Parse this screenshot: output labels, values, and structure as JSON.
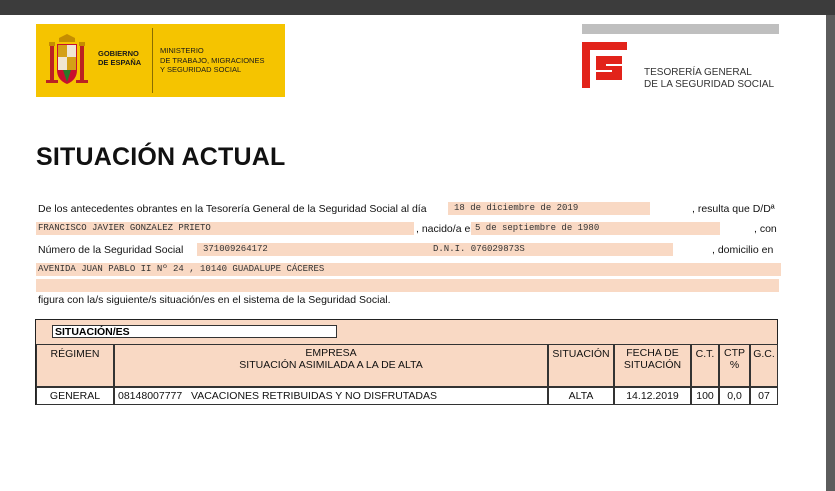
{
  "logos": {
    "gobierno": [
      "GOBIERNO",
      "DE ESPAÑA"
    ],
    "ministerio": [
      "MINISTERIO",
      "DE TRABAJO, MIGRACIONES",
      "Y SEGURIDAD SOCIAL"
    ],
    "tgss": [
      "TESORERÍA GENERAL",
      "DE LA SEGURIDAD SOCIAL"
    ]
  },
  "title": "SITUACIÓN ACTUAL",
  "body": {
    "line1_prefix": "De los antecedentes obrantes en la Tesorería General de la Seguridad Social al día",
    "date_issue": "18 de diciembre de 2019",
    "line1_suffix": ", resulta que D/Dª",
    "name": "FRANCISCO JAVIER GONZALEZ PRIETO",
    "born_label": ", nacido/a el",
    "birth_date": "5 de septiembre de 1980",
    "con_label": ", con",
    "nss_label": "Número de la Seguridad Social",
    "nss": "371009264172",
    "dni": "D.N.I. 076029873S",
    "domicilio_label": ", domicilio en",
    "address": "AVENIDA JUAN PABLO II Nº 24 , 10140 GUADALUPE CÁCERES",
    "address_line2": "",
    "closing": "figura con la/s siguiente/s situación/es en el sistema de la Seguridad Social."
  },
  "situacion": {
    "label": "SITUACIÓN/ES",
    "headers": {
      "regimen": "RÉGIMEN",
      "empresa_1": "EMPRESA",
      "empresa_2": "SITUACIÓN ASIMILADA A LA DE ALTA",
      "situacion": "SITUACIÓN",
      "fecha_1": "FECHA DE",
      "fecha_2": "SITUACIÓN",
      "ct": "C.T.",
      "ctp_1": "CTP",
      "ctp_2": "%",
      "gc": "G.C."
    },
    "row": {
      "regimen": "GENERAL",
      "empresa": "08148007777   VACACIONES RETRIBUIDAS Y NO DISFRUTADAS",
      "situacion": "ALTA",
      "fecha": "14.12.2019",
      "ct": "100",
      "ctp": "0,0",
      "gc": "07"
    }
  }
}
